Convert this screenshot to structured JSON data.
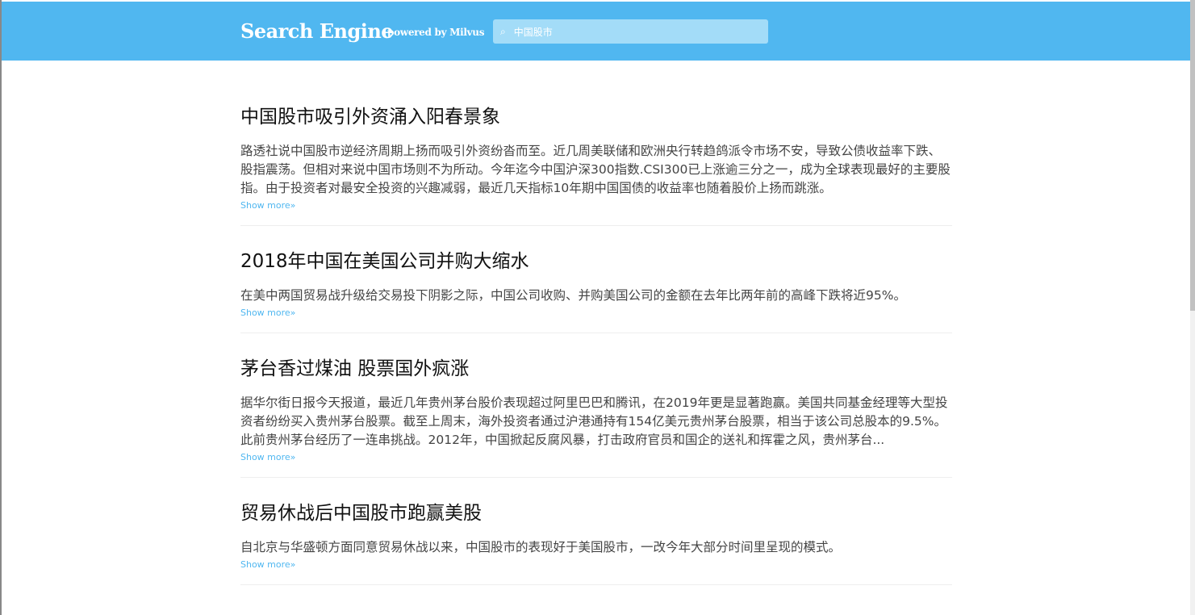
{
  "header": {
    "brand": "Search Engine",
    "powered": "powered by Milvus",
    "search_value": "中国股市",
    "search_icon": "search-icon"
  },
  "results": [
    {
      "title": "中国股市吸引外资涌入阳春景象",
      "body": "路透社说中国股市逆经济周期上扬而吸引外资纷沓而至。近几周美联储和欧洲央行转趋鸽派令市场不安，导致公债收益率下跌、股指震荡。但相对来说中国市场则不为所动。今年迄今中国沪深300指数.CSI300已上涨逾三分之一，成为全球表现最好的主要股指。由于投资者对最安全投资的兴趣减弱，最近几天指标10年期中国国债的收益率也随着股价上扬而跳涨。",
      "more": "Show more"
    },
    {
      "title": "2018年中国在美国公司并购大缩水",
      "body": "在美中两国贸易战升级给交易投下阴影之际，中国公司收购、并购美国公司的金额在去年比两年前的高峰下跌将近95%。",
      "more": "Show more"
    },
    {
      "title": "茅台香过煤油 股票国外疯涨",
      "body": "据华尔街日报今天报道，最近几年贵州茅台股价表现超过阿里巴巴和腾讯，在2019年更是显著跑赢。美国共同基金经理等大型投资者纷纷买入贵州茅台股票。截至上周末，海外投资者通过沪港通持有154亿美元贵州茅台股票，相当于该公司总股本的9.5%。此前贵州茅台经历了一连串挑战。2012年，中国掀起反腐风暴，打击政府官员和国企的送礼和挥霍之风，贵州茅台...",
      "more": "Show more"
    },
    {
      "title": "贸易休战后中国股市跑赢美股",
      "body": "自北京与华盛顿方面同意贸易休战以来，中国股市的表现好于美国股市，一改今年大部分时间里呈现的模式。",
      "more": "Show more"
    }
  ]
}
